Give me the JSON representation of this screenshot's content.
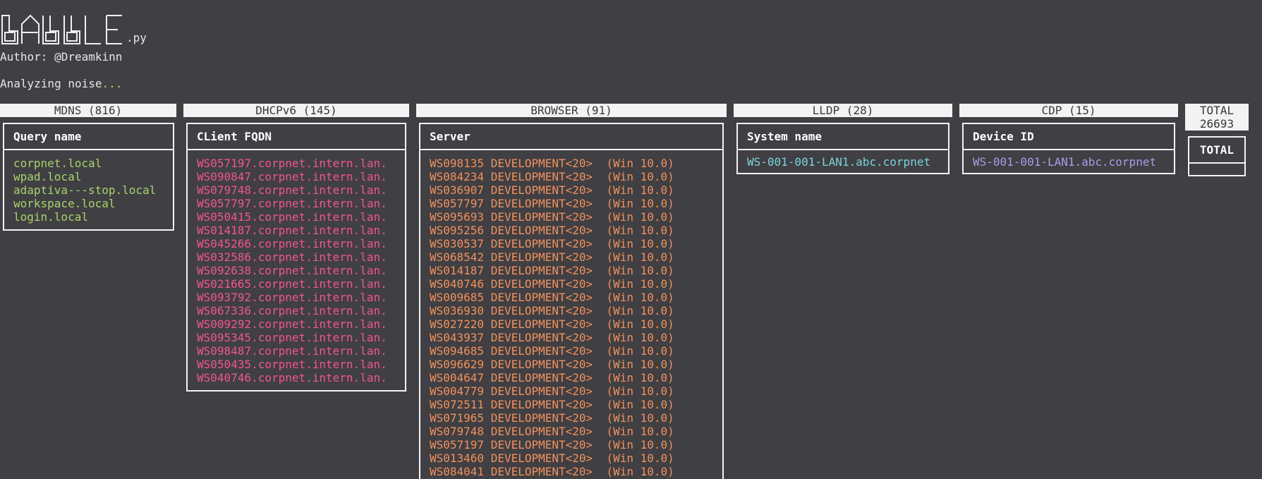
{
  "header": {
    "logo_text": "BABBLE",
    "logo_suffix": ".py",
    "author": "Author: @Dreamkinn",
    "status_text": "Analyzing noise",
    "status_dots": "..."
  },
  "colors": {
    "background": "#403f43",
    "mdns": "#a9d46b",
    "dhcpv6": "#f0578b",
    "browser": "#f0915c",
    "lldp": "#79d4dc",
    "cdp": "#ab9ce8"
  },
  "columns": {
    "mdns": {
      "title": "MDNS (816)",
      "field": "Query name",
      "rows": [
        "corpnet.local",
        "wpad.local",
        "adaptiva---stop.local",
        "workspace.local",
        "login.local"
      ]
    },
    "dhcpv6": {
      "title": "DHCPv6 (145)",
      "field": "CLient FQDN",
      "rows": [
        "WS057197.corpnet.intern.lan.",
        "WS090847.corpnet.intern.lan.",
        "WS079748.corpnet.intern.lan.",
        "WS057797.corpnet.intern.lan.",
        "WS050415.corpnet.intern.lan.",
        "WS014187.corpnet.intern.lan.",
        "WS045266.corpnet.intern.lan.",
        "WS032586.corpnet.intern.lan.",
        "WS092638.corpnet.intern.lan.",
        "WS021665.corpnet.intern.lan.",
        "WS093792.corpnet.intern.lan.",
        "WS067336.corpnet.intern.lan.",
        "WS009292.corpnet.intern.lan.",
        "WS095345.corpnet.intern.lan.",
        "WS098487.corpnet.intern.lan.",
        "WS050435.corpnet.intern.lan.",
        "WS040746.corpnet.intern.lan."
      ]
    },
    "browser": {
      "title": "BROWSER (91)",
      "field": "Server",
      "rows": [
        "WS098135 DEVELOPMENT<20>  (Win 10.0)",
        "WS084234 DEVELOPMENT<20>  (Win 10.0)",
        "WS036907 DEVELOPMENT<20>  (Win 10.0)",
        "WS057797 DEVELOPMENT<20>  (Win 10.0)",
        "WS095693 DEVELOPMENT<20>  (Win 10.0)",
        "WS095256 DEVELOPMENT<20>  (Win 10.0)",
        "WS030537 DEVELOPMENT<20>  (Win 10.0)",
        "WS068542 DEVELOPMENT<20>  (Win 10.0)",
        "WS014187 DEVELOPMENT<20>  (Win 10.0)",
        "WS040746 DEVELOPMENT<20>  (Win 10.0)",
        "WS009685 DEVELOPMENT<20>  (Win 10.0)",
        "WS036930 DEVELOPMENT<20>  (Win 10.0)",
        "WS027220 DEVELOPMENT<20>  (Win 10.0)",
        "WS043937 DEVELOPMENT<20>  (Win 10.0)",
        "WS094685 DEVELOPMENT<20>  (Win 10.0)",
        "WS096629 DEVELOPMENT<20>  (Win 10.0)",
        "WS004647 DEVELOPMENT<20>  (Win 10.0)",
        "WS004779 DEVELOPMENT<20>  (Win 10.0)",
        "WS072511 DEVELOPMENT<20>  (Win 10.0)",
        "WS071965 DEVELOPMENT<20>  (Win 10.0)",
        "WS079748 DEVELOPMENT<20>  (Win 10.0)",
        "WS057197 DEVELOPMENT<20>  (Win 10.0)",
        "WS013460 DEVELOPMENT<20>  (Win 10.0)",
        "WS084041 DEVELOPMENT<20>  (Win 10.0)"
      ]
    },
    "lldp": {
      "title": "LLDP (28)",
      "field": "System name",
      "rows": [
        "WS-001-001-LAN1.abc.corpnet"
      ]
    },
    "cdp": {
      "title": "CDP (15)",
      "field": "Device ID",
      "rows": [
        "WS-001-001-LAN1.abc.corpnet"
      ]
    },
    "total": {
      "label": "TOTAL",
      "count": "26693",
      "field": "TOTAL"
    }
  }
}
